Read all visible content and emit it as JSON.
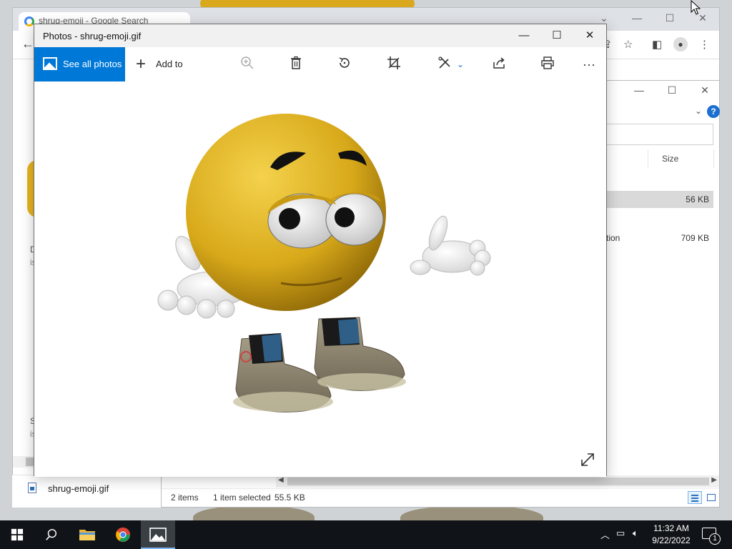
{
  "chrome": {
    "tab_title": "shrug-emoji - Google Search",
    "minimize": "—",
    "maximize": "☐",
    "close": "✕",
    "back": "←"
  },
  "explorer": {
    "size_header": "Size",
    "selected_size": "56 KB",
    "row2_name": "tion",
    "row2_size": "709 KB",
    "status_items": "2 items",
    "status_selected": "1 item selected",
    "status_size": "55.5 KB",
    "left_file": "shrug-emoji.gif",
    "help": "?"
  },
  "photos": {
    "title": "Photos - shrug-emoji.gif",
    "see_all": "See all photos",
    "add_to": "Add to",
    "more": "···",
    "minimize": "—",
    "maximize": "☐",
    "close": "✕"
  },
  "taskbar": {
    "time": "11:32 AM",
    "date": "9/22/2022",
    "notifications_count": "1"
  },
  "icons": [
    "windows-icon",
    "search-icon",
    "file-explorer-icon",
    "chrome-icon",
    "photos-icon"
  ]
}
